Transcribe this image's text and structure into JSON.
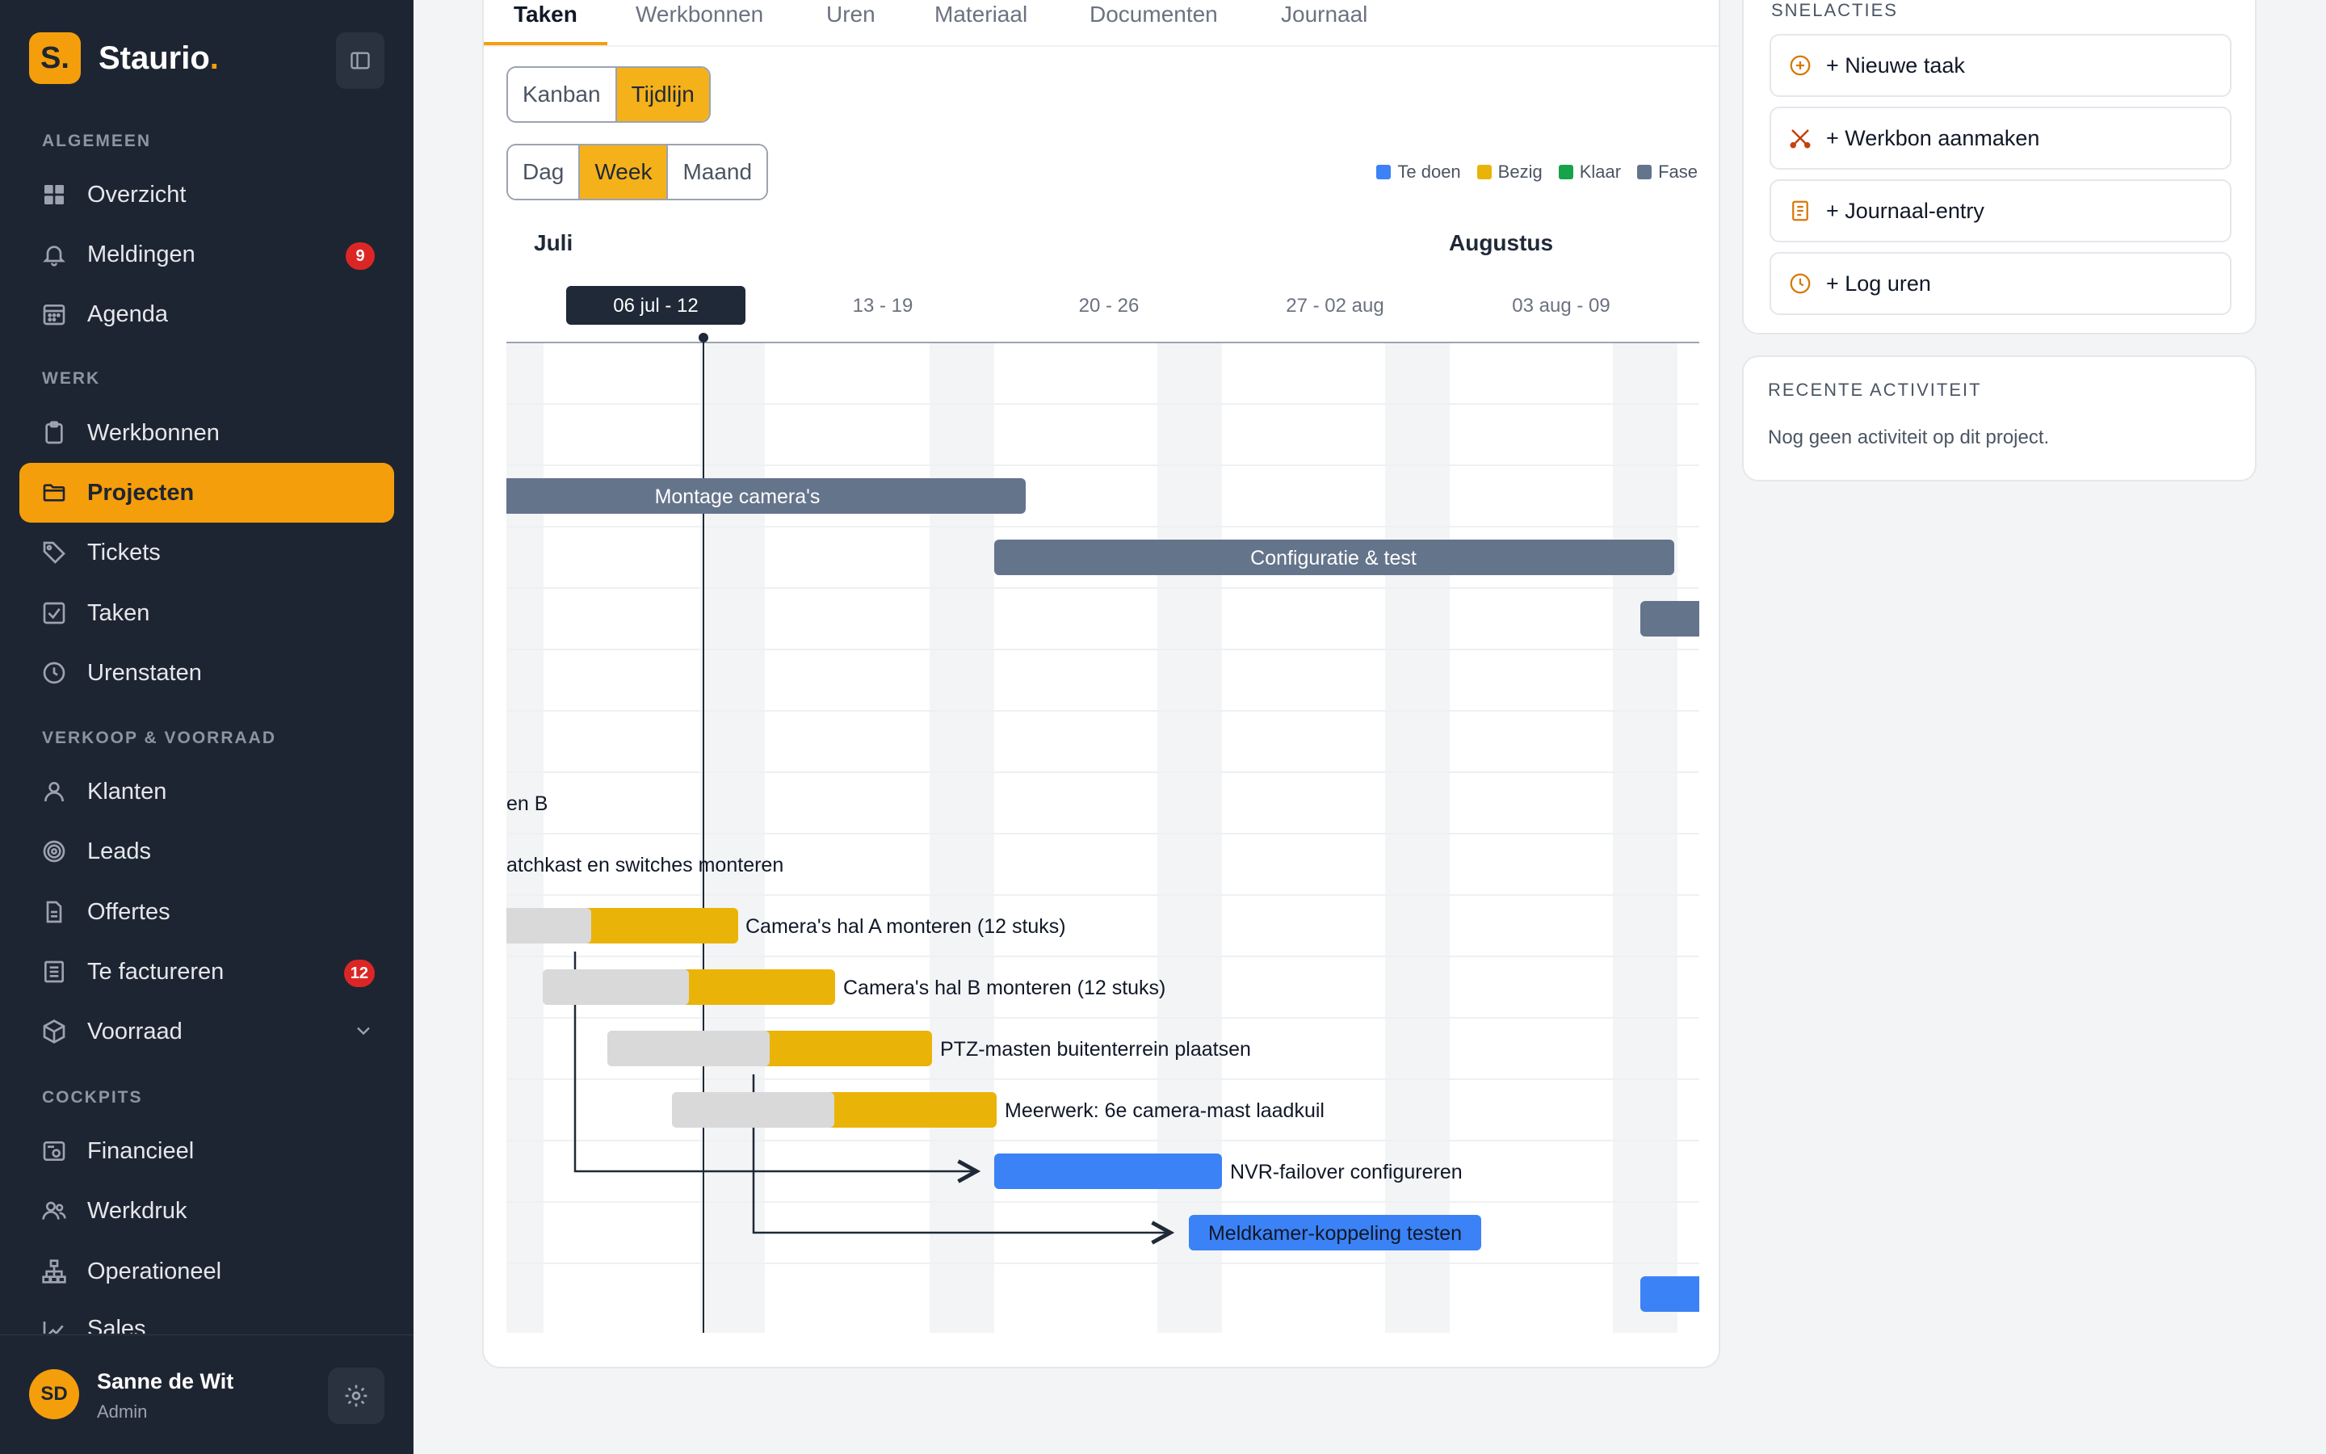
{
  "app": {
    "logo_letter": "S.",
    "name": "Staurio",
    "name_dot": "."
  },
  "sidebar": {
    "sections": {
      "general": "ALGEMEEN",
      "work": "WERK",
      "sales": "VERKOOP & VOORRAAD",
      "cockpits": "COCKPITS"
    },
    "items": {
      "overview": "Overzicht",
      "notifications": "Meldingen",
      "notifications_badge": "9",
      "agenda": "Agenda",
      "workorders": "Werkbonnen",
      "projects": "Projecten",
      "tickets": "Tickets",
      "tasks": "Taken",
      "timesheets": "Urenstaten",
      "customers": "Klanten",
      "leads": "Leads",
      "quotes": "Offertes",
      "to_invoice": "Te factureren",
      "to_invoice_badge": "12",
      "stock": "Voorraad",
      "financial": "Financieel",
      "workload": "Werkdruk",
      "operational": "Operationeel",
      "sales": "Sales"
    },
    "user": {
      "initials": "SD",
      "name": "Sanne de Wit",
      "role": "Admin"
    }
  },
  "main": {
    "tabs": [
      "Taken",
      "Werkbonnen",
      "Uren",
      "Materiaal",
      "Documenten",
      "Journaal"
    ],
    "view_toggle": {
      "kanban": "Kanban",
      "timeline": "Tijdlijn",
      "selected": "Tijdlijn"
    },
    "range_toggle": {
      "day": "Dag",
      "week": "Week",
      "month": "Maand",
      "selected": "Week"
    },
    "legend": [
      {
        "label": "Te doen",
        "color": "#3b82f6"
      },
      {
        "label": "Bezig",
        "color": "#eab308"
      },
      {
        "label": "Klaar",
        "color": "#16a34a"
      },
      {
        "label": "Fase",
        "color": "#64748b"
      }
    ],
    "timeline": {
      "months": [
        "Juli",
        "Augustus"
      ],
      "weeks": [
        "06 jul - 12",
        "13 - 19",
        "20 - 26",
        "27 - 02 aug",
        "03 aug - 09"
      ],
      "current_week": "06 jul - 12",
      "phases": [
        "Montage camera's",
        "Configuratie & test"
      ],
      "tasks": [
        {
          "label": "en B"
        },
        {
          "label": "atchkast en switches monteren"
        },
        {
          "label": "Camera's hal A monteren (12 stuks)",
          "status": "Bezig",
          "progress": 0.37
        },
        {
          "label": "Camera's hal B monteren (12 stuks)",
          "status": "Bezig",
          "progress": 0.5
        },
        {
          "label": "PTZ-masten buitenterrein plaatsen",
          "status": "Bezig",
          "progress": 0.5
        },
        {
          "label": "Meerwerk: 6e camera-mast laadkuil",
          "status": "Bezig",
          "progress": 0.5
        },
        {
          "label": "NVR-failover configureren",
          "status": "Te doen"
        },
        {
          "label": "Meldkamer-koppeling testen",
          "status": "Te doen"
        }
      ]
    }
  },
  "quick_actions": {
    "title": "SNELACTIES",
    "items": [
      "+ Nieuwe taak",
      "+ Werkbon aanmaken",
      "+ Journaal-entry",
      "+ Log uren"
    ]
  },
  "recent_activity": {
    "title": "RECENTE ACTIVITEIT",
    "empty": "Nog geen activiteit op dit project."
  }
}
